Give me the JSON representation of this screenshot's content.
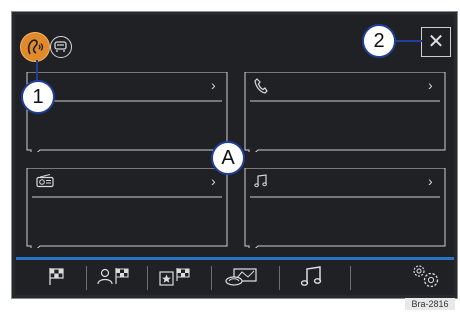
{
  "callouts": {
    "one": "1",
    "two": "2",
    "a": "A"
  },
  "header": {
    "close_glyph": "✕"
  },
  "tiles": [
    {
      "name": "tile-top-left",
      "chevron": "›",
      "icon": "none"
    },
    {
      "name": "tile-phone",
      "chevron": "›",
      "icon": "phone-icon"
    },
    {
      "name": "tile-radio",
      "chevron": "›",
      "icon": "radio-icon"
    },
    {
      "name": "tile-media",
      "chevron": "›",
      "icon": "music-note-icon"
    }
  ],
  "bottom_bar": {
    "items": [
      "destination-flag-icon",
      "contacts-destination-icon",
      "favorite-destination-icon",
      "route-map-icon",
      "music-icon",
      "settings-gears-icon"
    ]
  },
  "figure_ref": "Bra-2816",
  "colors": {
    "screen": "#1f2124",
    "accent_orange": "#e08a2c",
    "bar_blue": "#2a73c9",
    "callout_blue": "#1f3f9a"
  }
}
